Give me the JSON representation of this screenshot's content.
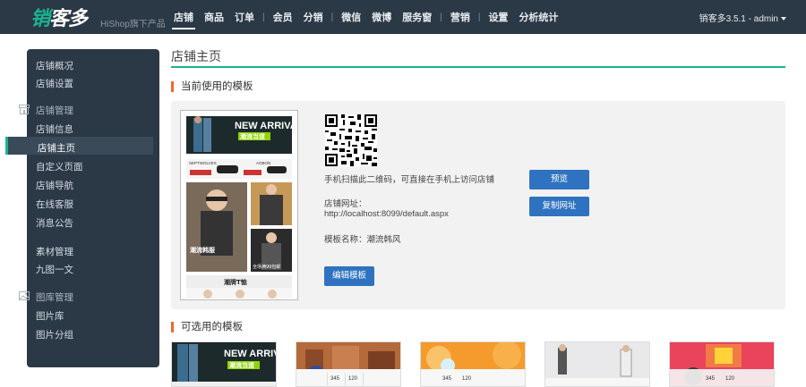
{
  "brand": {
    "logo_first": "销",
    "logo_rest": "客多",
    "tagline": "HiShop旗下产品"
  },
  "nav": [
    {
      "label": "店铺",
      "active": true
    },
    {
      "label": "商品"
    },
    {
      "label": "订单"
    },
    {
      "sep": "|"
    },
    {
      "label": "会员"
    },
    {
      "label": "分销"
    },
    {
      "sep": "|"
    },
    {
      "label": "微信"
    },
    {
      "label": "微博"
    },
    {
      "label": "服务窗"
    },
    {
      "sep": "|"
    },
    {
      "label": "营销"
    },
    {
      "sep": "|"
    },
    {
      "label": "设置"
    },
    {
      "label": "分析统计"
    }
  ],
  "user": "销客多3.5.1 - admin",
  "sidebar": {
    "items": [
      {
        "label": "店铺概况"
      },
      {
        "label": "店铺设置"
      },
      {
        "label": "店铺管理",
        "group": true,
        "icon": "store-icon"
      },
      {
        "label": "店铺信息"
      },
      {
        "label": "店铺主页",
        "active": true
      },
      {
        "label": "自定义页面"
      },
      {
        "label": "店铺导航"
      },
      {
        "label": "在线客服"
      },
      {
        "label": "消息公告"
      },
      {
        "label": "素材管理"
      },
      {
        "label": "九图一文"
      },
      {
        "label": "图库管理",
        "group": true,
        "icon": "image-icon"
      },
      {
        "label": "图片库"
      },
      {
        "label": "图片分组"
      }
    ]
  },
  "main": {
    "title": "店铺主页",
    "current_section": "当前使用的模板",
    "qr_hint": "手机扫描此二维码，可直接在手机上访问店铺",
    "url_label": "店铺网址：",
    "url_value": "http://localhost:8099/default.aspx",
    "template_name": "模板名称：潮流韩风",
    "preview_button": "预览",
    "copy_button": "复制网址",
    "edit_button": "编辑模板",
    "available_section": "可选用的模板"
  },
  "thumbnail": {
    "headline": "NEW ARRIVAL",
    "sub": "潮流当道",
    "mid_left": "SEPTWOLVES",
    "mid_right": "AOBON",
    "promo": "潮流韩服",
    "promo2": "全场满99包邮",
    "bottom": "潮牌T恤",
    "price": "¥98"
  },
  "colors": {
    "accent": "#1ab394",
    "dark": "#2b3845",
    "button": "#2f73c0",
    "marker": "#f0692a"
  }
}
